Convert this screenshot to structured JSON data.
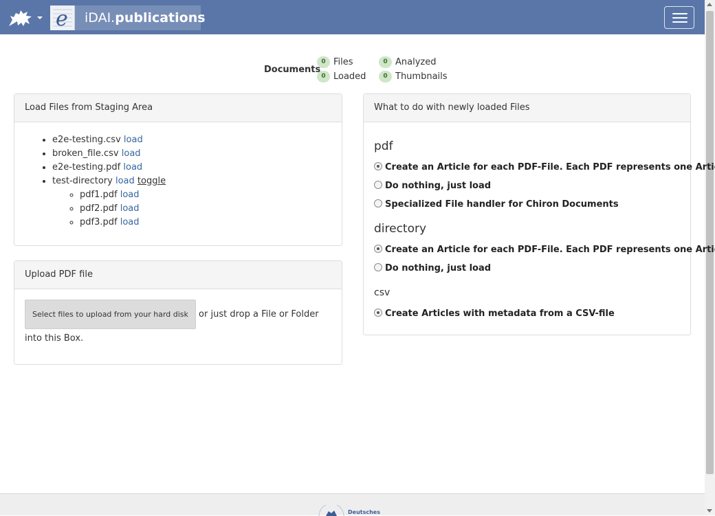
{
  "header": {
    "brand_prefix": "iDAI.",
    "brand_name": "publications",
    "brand_letter": "e",
    "accent_color": "#5a76a8"
  },
  "documents": {
    "label": "Documents",
    "stats": [
      {
        "count": "0",
        "label": "Files"
      },
      {
        "count": "0",
        "label": "Analyzed"
      },
      {
        "count": "0",
        "label": "Loaded"
      },
      {
        "count": "0",
        "label": "Thumbnails"
      }
    ]
  },
  "staging": {
    "title": "Load Files from Staging Area",
    "load_label": "load",
    "toggle_label": "toggle",
    "files": [
      {
        "name": "e2e-testing.csv"
      },
      {
        "name": "broken_file.csv"
      },
      {
        "name": "e2e-testing.pdf"
      },
      {
        "name": "test-directory",
        "children": [
          "pdf1.pdf",
          "pdf2.pdf",
          "pdf3.pdf"
        ]
      }
    ]
  },
  "upload": {
    "title": "Upload PDF file",
    "button_label": "Select files to upload from your hard disk",
    "hint": "or just drop a File or Folder into this Box."
  },
  "options": {
    "title": "What to do with newly loaded Files",
    "sections": [
      {
        "name": "pdf",
        "choices": [
          {
            "label": "Create an Article for each PDF-File. Each PDF represents one Article.",
            "checked": true
          },
          {
            "label": "Do nothing, just load",
            "checked": false
          },
          {
            "label": "Specialized File handler for Chiron Documents",
            "checked": false
          }
        ]
      },
      {
        "name": "directory",
        "choices": [
          {
            "label": "Create an Article for each PDF-File. Each PDF represents one Article.",
            "checked": true
          },
          {
            "label": "Do nothing, just load",
            "checked": false
          }
        ]
      },
      {
        "name": "csv",
        "choices": [
          {
            "label": "Create Articles with metadata from a CSV-file",
            "checked": true
          }
        ]
      }
    ]
  },
  "footer": {
    "logo_text": "Deutsches"
  }
}
